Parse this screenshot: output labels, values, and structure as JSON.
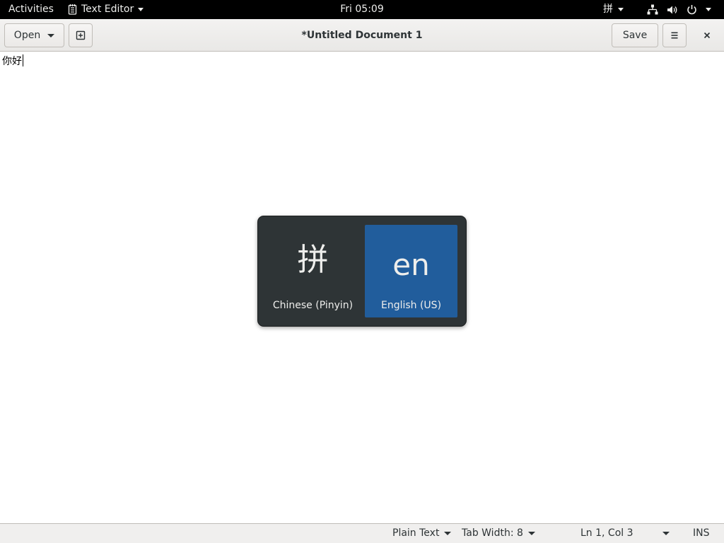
{
  "topbar": {
    "activities": "Activities",
    "app_name": "Text Editor",
    "clock": "Fri 05:09",
    "input_method_indicator": "拼"
  },
  "headerbar": {
    "open_label": "Open",
    "title": "*Untitled Document 1",
    "save_label": "Save"
  },
  "editor": {
    "content": "你好"
  },
  "input_switcher": {
    "items": [
      {
        "glyph": "拼",
        "label": "Chinese (Pinyin)",
        "selected": false
      },
      {
        "glyph": "en",
        "label": "English (US)",
        "selected": true
      }
    ]
  },
  "statusbar": {
    "language": "Plain Text",
    "tab_width": "Tab Width: 8",
    "position": "Ln 1, Col 3",
    "mode": "INS"
  },
  "colors": {
    "topbar_bg": "#000000",
    "switcher_bg": "#2e3436",
    "selected_bg": "#215d9c"
  },
  "icons": [
    "text-editor-icon",
    "new-tab-icon",
    "hamburger-menu-icon",
    "close-icon",
    "network-icon",
    "volume-icon",
    "power-icon"
  ]
}
